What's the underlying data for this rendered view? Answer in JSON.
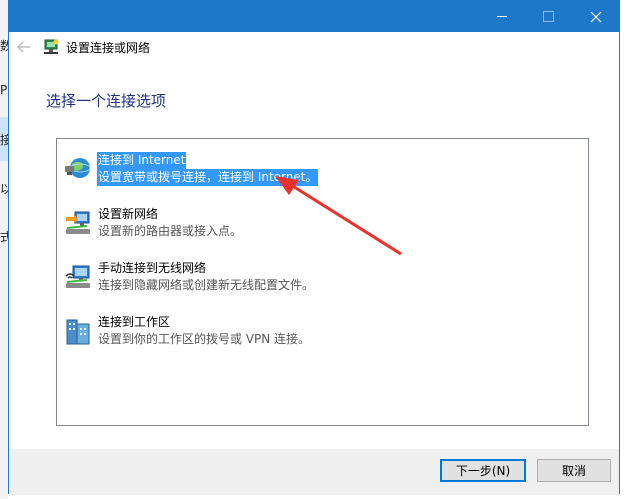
{
  "background_window": {
    "chars": [
      "数",
      "P",
      "接",
      "以",
      "式"
    ]
  },
  "window": {
    "title": "设置连接或网络",
    "accent_color": "#1e78c8",
    "caption_icons": [
      "minimize-icon",
      "maximize-icon",
      "close-icon"
    ]
  },
  "instruction": "选择一个连接选项",
  "options": [
    {
      "title": "连接到 Internet",
      "desc": "设置宽带或拨号连接，连接到 Internet。",
      "icon": "globe-network-icon",
      "selected": true
    },
    {
      "title": "设置新网络",
      "desc": "设置新的路由器或接入点。",
      "icon": "new-network-icon",
      "selected": false
    },
    {
      "title": "手动连接到无线网络",
      "desc": "连接到隐藏网络或创建新无线配置文件。",
      "icon": "wireless-network-icon",
      "selected": false
    },
    {
      "title": "连接到工作区",
      "desc": "设置到你的工作区的拨号或 VPN 连接。",
      "icon": "workplace-icon",
      "selected": false
    }
  ],
  "buttons": {
    "next": "下一步(N)",
    "cancel": "取消"
  },
  "selection_color": "#3399ff",
  "annotation_color": "#e8332a"
}
